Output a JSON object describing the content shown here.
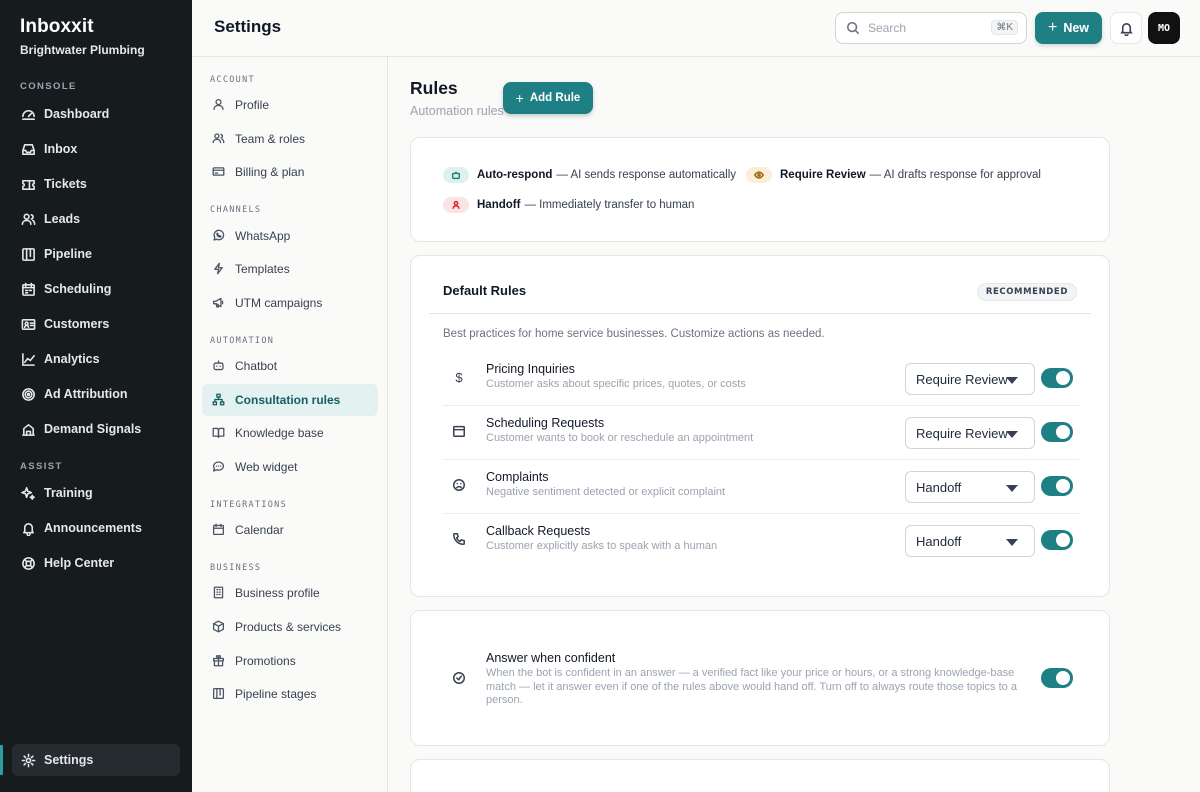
{
  "app": {
    "name": "Inboxxit",
    "org": "Brightwater Plumbing"
  },
  "sidebar": {
    "sections": {
      "console": "CONSOLE",
      "assist": "ASSIST"
    },
    "console_items": [
      {
        "label": "Dashboard",
        "icon": "dashboard-icon"
      },
      {
        "label": "Inbox",
        "icon": "inbox-icon"
      },
      {
        "label": "Tickets",
        "icon": "ticket-icon"
      },
      {
        "label": "Leads",
        "icon": "users-icon"
      },
      {
        "label": "Pipeline",
        "icon": "pipeline-icon"
      },
      {
        "label": "Scheduling",
        "icon": "calendar-icon"
      },
      {
        "label": "Customers",
        "icon": "contact-card-icon"
      },
      {
        "label": "Analytics",
        "icon": "line-chart-icon"
      },
      {
        "label": "Ad Attribution",
        "icon": "target-icon"
      },
      {
        "label": "Demand Signals",
        "icon": "building-icon"
      }
    ],
    "assist_items": [
      {
        "label": "Training",
        "icon": "sparkles-icon"
      },
      {
        "label": "Announcements",
        "icon": "bell-icon"
      },
      {
        "label": "Help Center",
        "icon": "lifebuoy-icon"
      }
    ],
    "settings": {
      "label": "Settings",
      "icon": "gear-icon"
    }
  },
  "header": {
    "title": "Settings",
    "search_placeholder": "Search",
    "search_shortcut": "⌘K",
    "new_label": "New",
    "avatar_initials": "MO"
  },
  "settings_nav": {
    "account_title": "ACCOUNT",
    "account": [
      "Profile",
      "Team & roles",
      "Billing & plan"
    ],
    "channels_title": "CHANNELS",
    "channels": [
      "WhatsApp",
      "Templates",
      "UTM campaigns"
    ],
    "automation_title": "AUTOMATION",
    "automation": [
      "Chatbot",
      "Consultation rules",
      "Knowledge base",
      "Web widget"
    ],
    "integrations_title": "INTEGRATIONS",
    "integrations": [
      "Calendar"
    ],
    "business_title": "BUSINESS",
    "business": [
      "Business profile",
      "Products & services",
      "Promotions",
      "Pipeline stages"
    ]
  },
  "main": {
    "title": "Rules",
    "subtitle": "Automation rules",
    "add_rule_label": "Add Rule",
    "legend": {
      "auto_respond": {
        "name": "Auto-respond",
        "desc": "— AI sends response automatically"
      },
      "require_review": {
        "name": "Require Review",
        "desc": "— AI drafts response for approval"
      },
      "handoff": {
        "name": "Handoff",
        "desc": "— Immediately transfer to human"
      }
    },
    "default_rules": {
      "title": "Default Rules",
      "badge": "RECOMMENDED",
      "description": "Best practices for home service businesses. Customize actions as needed.",
      "rules": [
        {
          "name": "Pricing Inquiries",
          "desc": "Customer asks about specific prices, quotes, or costs",
          "action": "Require Review",
          "enabled": true,
          "icon": "dollar-icon"
        },
        {
          "name": "Scheduling Requests",
          "desc": "Customer wants to book or reschedule an appointment",
          "action": "Require Review",
          "enabled": true,
          "icon": "calendar-icon"
        },
        {
          "name": "Complaints",
          "desc": "Negative sentiment detected or explicit complaint",
          "action": "Handoff",
          "enabled": true,
          "icon": "frown-icon"
        },
        {
          "name": "Callback Requests",
          "desc": "Customer explicitly asks to speak with a human",
          "action": "Handoff",
          "enabled": true,
          "icon": "phone-icon"
        }
      ]
    },
    "confident": {
      "name": "Answer when confident",
      "desc": "When the bot is confident in an answer — a verified fact like your price or hours, or a strong knowledge-base match — let it answer even if one of the rules above would hand off. Turn off to always route those topics to a person.",
      "enabled": true
    }
  },
  "colors": {
    "accent": "#1e7f85",
    "sidebar_bg": "#161b1e"
  }
}
